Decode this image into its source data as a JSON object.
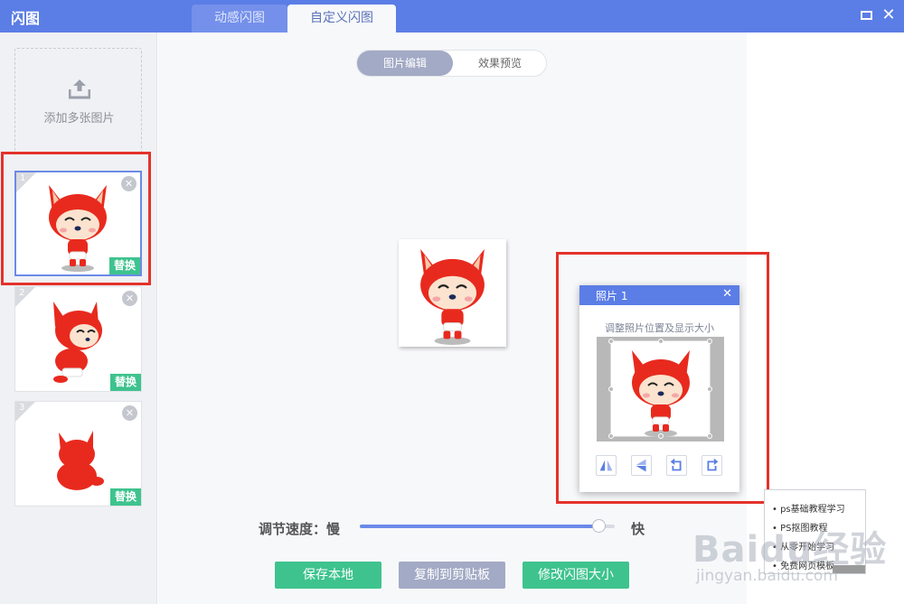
{
  "app": {
    "title": "闪图"
  },
  "tabs": [
    {
      "label": "动感闪图",
      "active": false
    },
    {
      "label": "自定义闪图",
      "active": true
    }
  ],
  "window": {
    "max_icon": "maximize-icon",
    "close_icon": "close-icon",
    "close_glyph": "✕"
  },
  "left_panel": {
    "add_label": "添加多张图片",
    "thumbnails": [
      {
        "number": "1",
        "replace_label": "替换",
        "close_glyph": "✕",
        "selected": true
      },
      {
        "number": "2",
        "replace_label": "替换",
        "close_glyph": "✕",
        "selected": false
      },
      {
        "number": "3",
        "replace_label": "替换",
        "close_glyph": "✕",
        "selected": false
      }
    ]
  },
  "editor": {
    "segments": [
      {
        "label": "图片编辑",
        "active": true
      },
      {
        "label": "效果预览",
        "active": false
      }
    ]
  },
  "photo_dialog": {
    "title": "照片 1",
    "close_glyph": "✕",
    "hint": "调整照片位置及显示大小",
    "tools": [
      "flip-horizontal-icon",
      "flip-vertical-icon",
      "rotate-left-icon",
      "rotate-right-icon"
    ]
  },
  "speed": {
    "label": "调节速度：慢",
    "fast_label": "快",
    "level": 0.94
  },
  "actions": {
    "save_label": "保存本地",
    "copy_label": "复制到剪贴板",
    "resize_label": "修改闪图大小"
  },
  "overlay_popup": {
    "items": [
      "ps基础教程学习",
      "PS抠图教程",
      "从零开始学习",
      "免费网页模板"
    ]
  },
  "watermark": {
    "main": "Baidu经验",
    "sub": "jingyan.baidu.com"
  },
  "colors": {
    "brand": "#5b7de6",
    "green": "#3ec38e",
    "gray_button": "#a3aac5",
    "highlight_red": "#e4322b"
  }
}
